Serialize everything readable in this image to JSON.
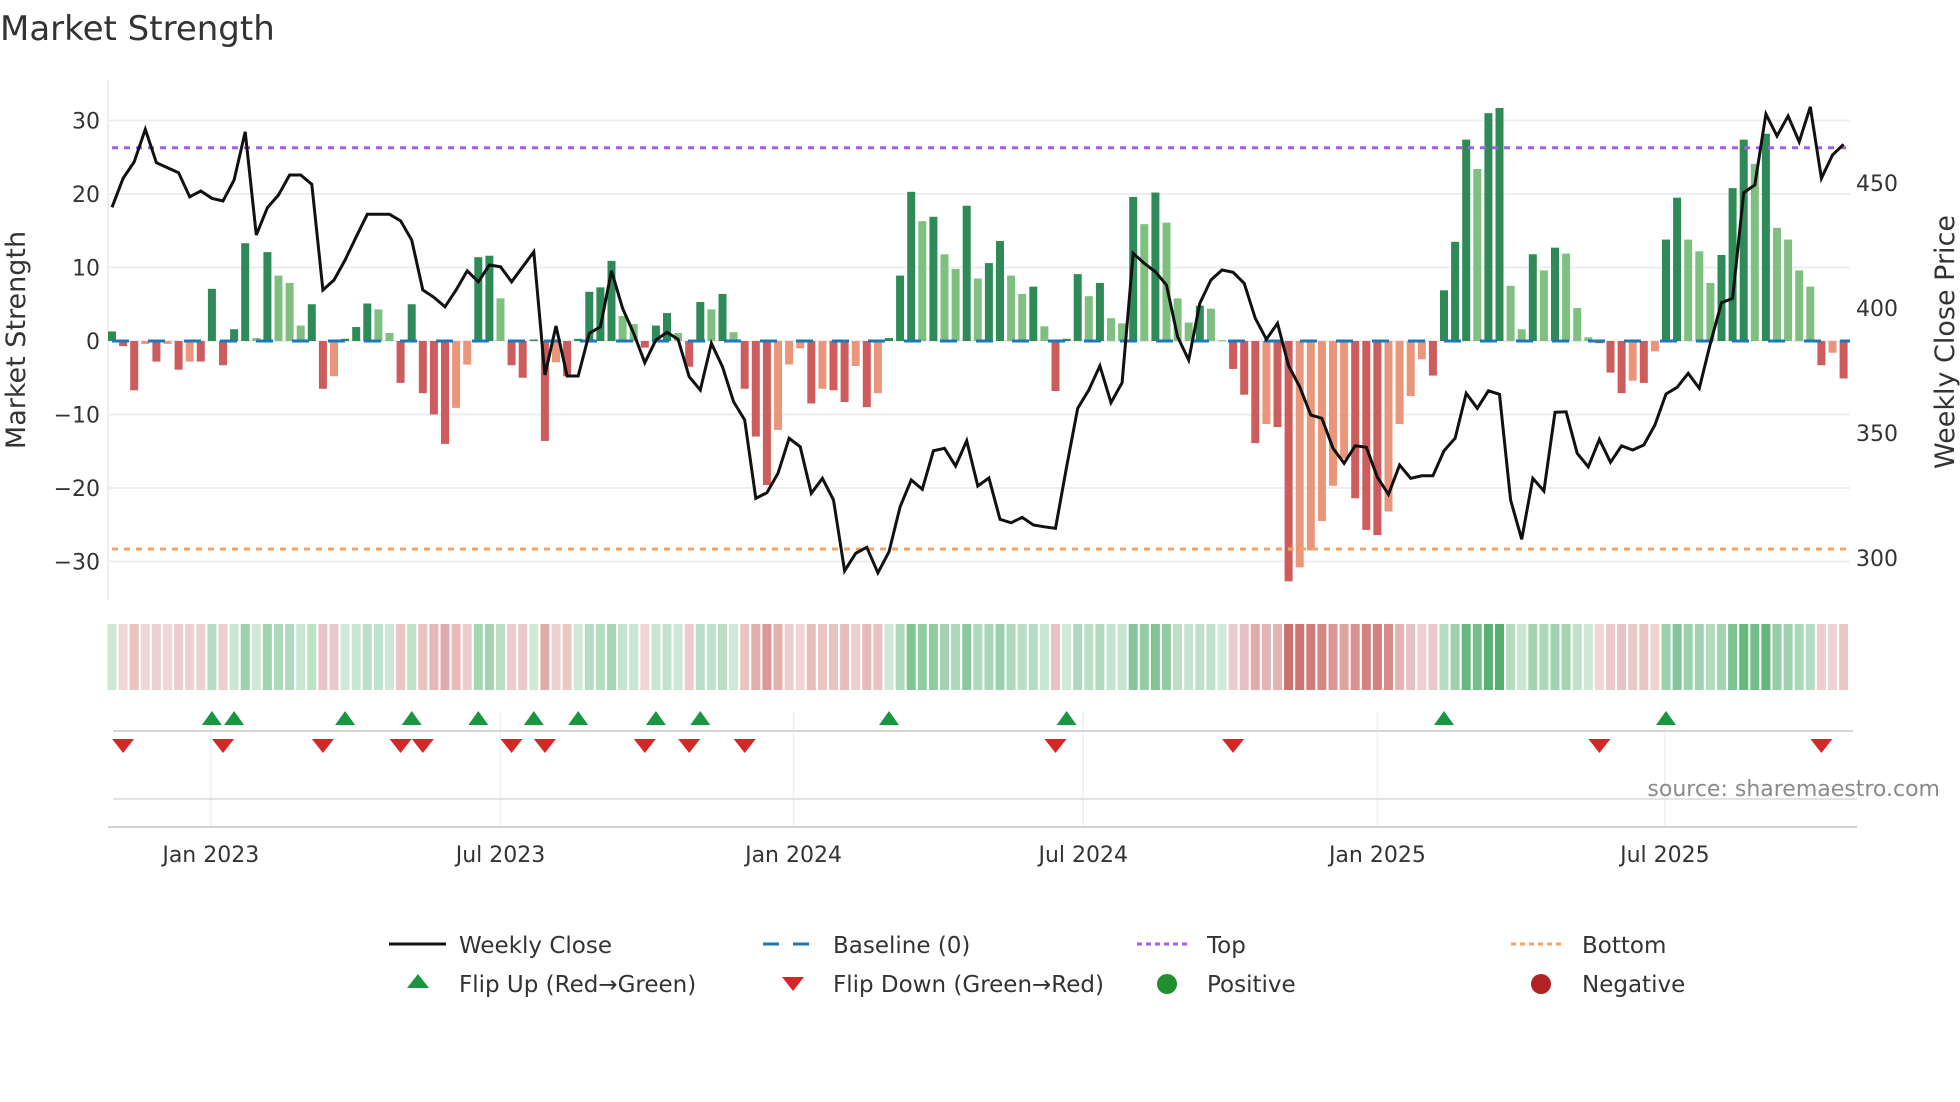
{
  "chart_data": {
    "type": "bar",
    "title": "Market Strength",
    "ylabel": "Market Strength",
    "y2label": "Weekly Close Price",
    "ylim": [
      -35,
      35
    ],
    "y2lim": [
      288,
      493
    ],
    "yticks": [
      -30,
      -20,
      -10,
      0,
      10,
      20,
      30
    ],
    "yticklabels": [
      "−30",
      "−20",
      "−10",
      "0",
      "10",
      "20",
      "30"
    ],
    "y2ticks": [
      300,
      350,
      400,
      450
    ],
    "y2ticklabels": [
      "300",
      "350",
      "400",
      "450"
    ],
    "xticks": [
      {
        "week": 9.9,
        "label": "Jan 2023"
      },
      {
        "week": 36,
        "label": "Jul 2023"
      },
      {
        "week": 62.4,
        "label": "Jan 2024"
      },
      {
        "week": 88.5,
        "label": "Jul 2024"
      },
      {
        "week": 115,
        "label": "Jan 2025"
      },
      {
        "week": 140.9,
        "label": "Jul 2025"
      }
    ],
    "grid": true,
    "top_level": 26.3,
    "bottom_level": -28.3,
    "baseline": 0,
    "strength": [
      1.3,
      -0.7,
      -6.7,
      -0.4,
      -2.8,
      -0.4,
      -3.9,
      -2.8,
      -2.8,
      7.1,
      -3.3,
      1.6,
      13.3,
      0.4,
      12.1,
      8.9,
      7.9,
      2.1,
      5.0,
      -6.5,
      -4.8,
      0.3,
      1.9,
      5.1,
      4.3,
      1.1,
      -5.7,
      5.0,
      -7.1,
      -10,
      -14,
      -9.1,
      -3.2,
      11.4,
      11.6,
      5.8,
      -3.3,
      -5.0,
      0.2,
      -13.6,
      -2.9,
      -4.8,
      0.3,
      6.7,
      7.3,
      10.9,
      3.4,
      2.3,
      -0.9,
      2.1,
      3.8,
      1.1,
      -3.5,
      5.3,
      4.3,
      6.4,
      1.2,
      -6.5,
      -13,
      -19.6,
      -12.1,
      -3.2,
      -1.0,
      -8.5,
      -6.5,
      -6.7,
      -8.3,
      -3.4,
      -9.0,
      -7.1,
      0.4,
      8.9,
      20.3,
      16.3,
      16.9,
      11.8,
      9.8,
      18.4,
      8.5,
      10.6,
      13.6,
      8.9,
      6.4,
      7.4,
      2.0,
      -6.8,
      0.3,
      9.1,
      6.1,
      7.9,
      3.1,
      2.4,
      19.6,
      15.9,
      20.2,
      16.1,
      5.8,
      2.5,
      4.8,
      4.4,
      0.1,
      -3.8,
      -7.3,
      -13.9,
      -11.3,
      -11.7,
      -32.7,
      -30.8,
      -28.5,
      -24.5,
      -19.7,
      -16,
      -21.4,
      -25.7,
      -26.4,
      -23.2,
      -11.3,
      -7.5,
      -2.5,
      -4.7,
      6.9,
      13.5,
      27.4,
      23.4,
      31.0,
      31.7,
      7.5,
      1.6,
      11.8,
      9.6,
      12.7,
      11.9,
      4.5,
      0.5,
      -0.3,
      -4.3,
      -7.1,
      -5.4,
      -5.7,
      -1.4,
      13.8,
      19.5,
      13.8,
      12.2,
      7.9,
      11.7,
      20.8,
      27.4,
      24.1,
      28.2,
      15.4,
      13.8,
      9.6,
      7.4,
      -3.3,
      -1.6,
      -5.1
    ],
    "weekly_close": [
      440.3,
      451.9,
      458.5,
      471.5,
      458.1,
      456.1,
      454.1,
      444.5,
      446.8,
      443.9,
      442.8,
      451.2,
      470.5,
      429.2,
      440.1,
      445.2,
      453.2,
      453.2,
      449.5,
      407.2,
      411.2,
      419.2,
      428.5,
      437.5,
      437.5,
      437.5,
      434.9,
      427.2,
      407.2,
      404.3,
      400.5,
      407.2,
      414.9,
      410.5,
      417.2,
      416.5,
      410.5,
      416.5,
      422.5,
      373.2,
      392.8,
      372.8,
      372.8,
      389.9,
      392.5,
      414.9,
      399.9,
      389.9,
      378.1,
      387.2,
      390.3,
      387.5,
      372.5,
      367.2,
      385.9,
      376.5,
      362.5,
      355.2,
      323.9,
      326.1,
      333.9,
      347.9,
      344.5,
      325.9,
      331.9,
      323.2,
      294.9,
      301.9,
      304.3,
      294.1,
      302.5,
      320.5,
      331.2,
      327.5,
      342.9,
      343.9,
      336.8,
      346.9,
      328.8,
      332,
      315.5,
      314.1,
      316.3,
      313.2,
      312.5,
      311.9,
      336.5,
      359.9,
      367.2,
      376.9,
      362.1,
      370.1,
      421.9,
      417.9,
      414.5,
      409.2,
      388.5,
      379.2,
      401.9,
      411.2,
      415.2,
      414.3,
      409.9,
      395.9,
      387.5,
      393.9,
      376.9,
      368.5,
      357.2,
      355.9,
      343.9,
      337.9,
      344.9,
      344.3,
      332.3,
      325.5,
      337.2,
      331.9,
      332.9,
      332.9,
      342.9,
      347.9,
      365.9,
      359.9,
      366.9,
      365.5,
      323.2,
      307.5,
      331.9,
      326.8,
      358.3,
      358.5,
      341.9,
      336.5,
      347.5,
      338.3,
      344.9,
      343.2,
      345.2,
      353.2,
      365.6,
      368.3,
      373.9,
      367.9,
      385.9,
      402.1,
      403.9,
      446.1,
      449.2,
      477.6,
      468.8,
      476.8,
      466.5,
      480.5,
      451.9,
      461.2,
      465.5
    ],
    "flip_up_weeks": [
      10,
      12,
      22,
      28,
      34,
      39,
      43,
      50,
      54,
      71,
      87,
      121,
      141
    ],
    "flip_down_weeks": [
      2,
      11,
      20,
      27,
      29,
      37,
      40,
      49,
      53,
      58,
      86,
      102,
      135,
      155
    ],
    "colors": {
      "rising_positive": "#2e8b57",
      "falling_positive": "#7fbf7f",
      "falling_negative": "#cd5c5c",
      "rising_negative": "#e9967a",
      "price_line": "#111111",
      "baseline": "#1f77b4",
      "top": "#a45ee5",
      "bottom": "#f4a460",
      "flip_up": "#1a9641",
      "flip_down": "#d62728",
      "positive": "#1f8f2f",
      "negative": "#b22222"
    },
    "legend": {
      "position": "bottom",
      "items": [
        {
          "label": "Weekly Close",
          "symbol": "line"
        },
        {
          "label": "Baseline (0)",
          "symbol": "dash"
        },
        {
          "label": "Top",
          "symbol": "dot"
        },
        {
          "label": "Bottom",
          "symbol": "dot"
        },
        {
          "label": "Flip Up (Red→Green)",
          "symbol": "triangle-up"
        },
        {
          "label": "Flip Down (Green→Red)",
          "symbol": "triangle-down"
        },
        {
          "label": "Positive",
          "symbol": "circle"
        },
        {
          "label": "Negative",
          "symbol": "circle"
        }
      ]
    },
    "source": "source: sharemaestro.com"
  }
}
